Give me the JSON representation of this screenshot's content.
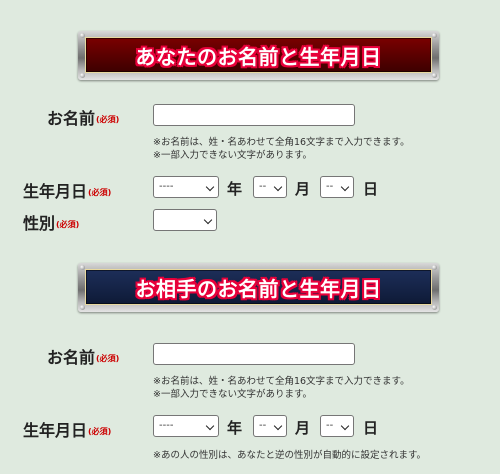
{
  "section1": {
    "banner_title": "あなたのお名前と生年月日",
    "name_label": "お名前",
    "required": "(必須)",
    "name_value": "",
    "note_line1": "※お名前は、姓・名あわせて全角16文字まで入力できます。",
    "note_line2": "※一部入力できない文字があります。",
    "birth_label": "生年月日",
    "year_value": "----",
    "year_unit": "年",
    "month_value": "--",
    "month_unit": "月",
    "day_value": "--",
    "day_unit": "日",
    "gender_label": "性別",
    "gender_value": ""
  },
  "section2": {
    "banner_title": "お相手のお名前と生年月日",
    "name_label": "お名前",
    "required": "(必須)",
    "name_value": "",
    "note_line1": "※お名前は、姓・名あわせて全角16文字まで入力できます。",
    "note_line2": "※一部入力できない文字があります。",
    "birth_label": "生年月日",
    "year_value": "----",
    "year_unit": "年",
    "month_value": "--",
    "month_unit": "月",
    "day_value": "--",
    "day_unit": "日",
    "gender_note": "※あの人の性別は、あなたと逆の性別が自動的に設定されます。"
  },
  "colors": {
    "background": "#dfeadf",
    "banner1": "#5a0000",
    "banner2": "#16244a",
    "title_outline": "#e8003a",
    "required_text": "#cc0000"
  }
}
